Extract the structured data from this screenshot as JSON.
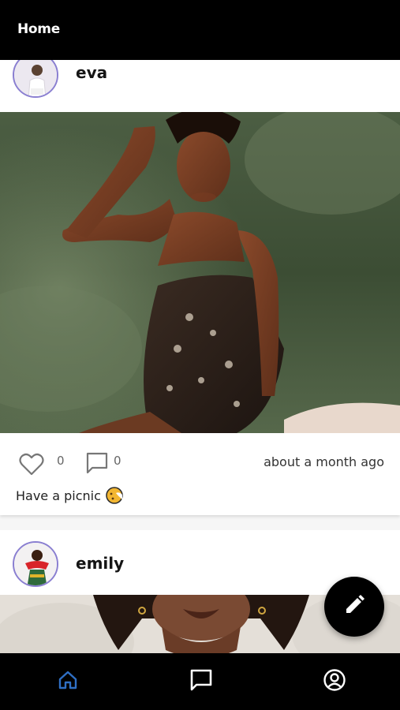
{
  "app": {
    "title": "Home"
  },
  "posts": [
    {
      "username": "eva",
      "likes": "0",
      "comments": "0",
      "time": "about a month ago",
      "caption": "Have a picnic",
      "caption_emoji": "cookie-emoji-icon"
    },
    {
      "username": "emily"
    }
  ],
  "fab": {
    "icon": "pencil-icon"
  },
  "bottom_nav": {
    "items": [
      {
        "icon": "home-icon",
        "active": true,
        "color": "#2f6fc4"
      },
      {
        "icon": "chat-icon",
        "active": false,
        "color": "#ffffff"
      },
      {
        "icon": "profile-icon",
        "active": false,
        "color": "#ffffff"
      }
    ]
  },
  "colors": {
    "bar": "#000000",
    "accent": "#2f6fc4",
    "avatar_ring": "#8a7fd1"
  }
}
